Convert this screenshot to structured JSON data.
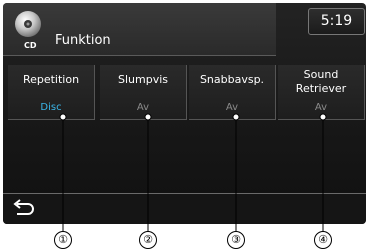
{
  "header": {
    "title": "Funktion",
    "source_label": "CD",
    "clock": "5:19"
  },
  "tiles": [
    {
      "label": "Repetition",
      "value": "Disc",
      "active": true
    },
    {
      "label": "Slumpvis",
      "value": "Av",
      "active": false
    },
    {
      "label": "Snabbavsp.",
      "value": "Av",
      "active": false
    },
    {
      "label": "Sound\nRetriever",
      "value": "Av",
      "active": false
    }
  ],
  "callouts": [
    "①",
    "②",
    "③",
    "④"
  ],
  "colors": {
    "accent": "#3ab6e8",
    "inactive_value": "#8a8a8a"
  },
  "icons": {
    "source": "cd-disc-icon",
    "back": "back-arrow-icon"
  }
}
